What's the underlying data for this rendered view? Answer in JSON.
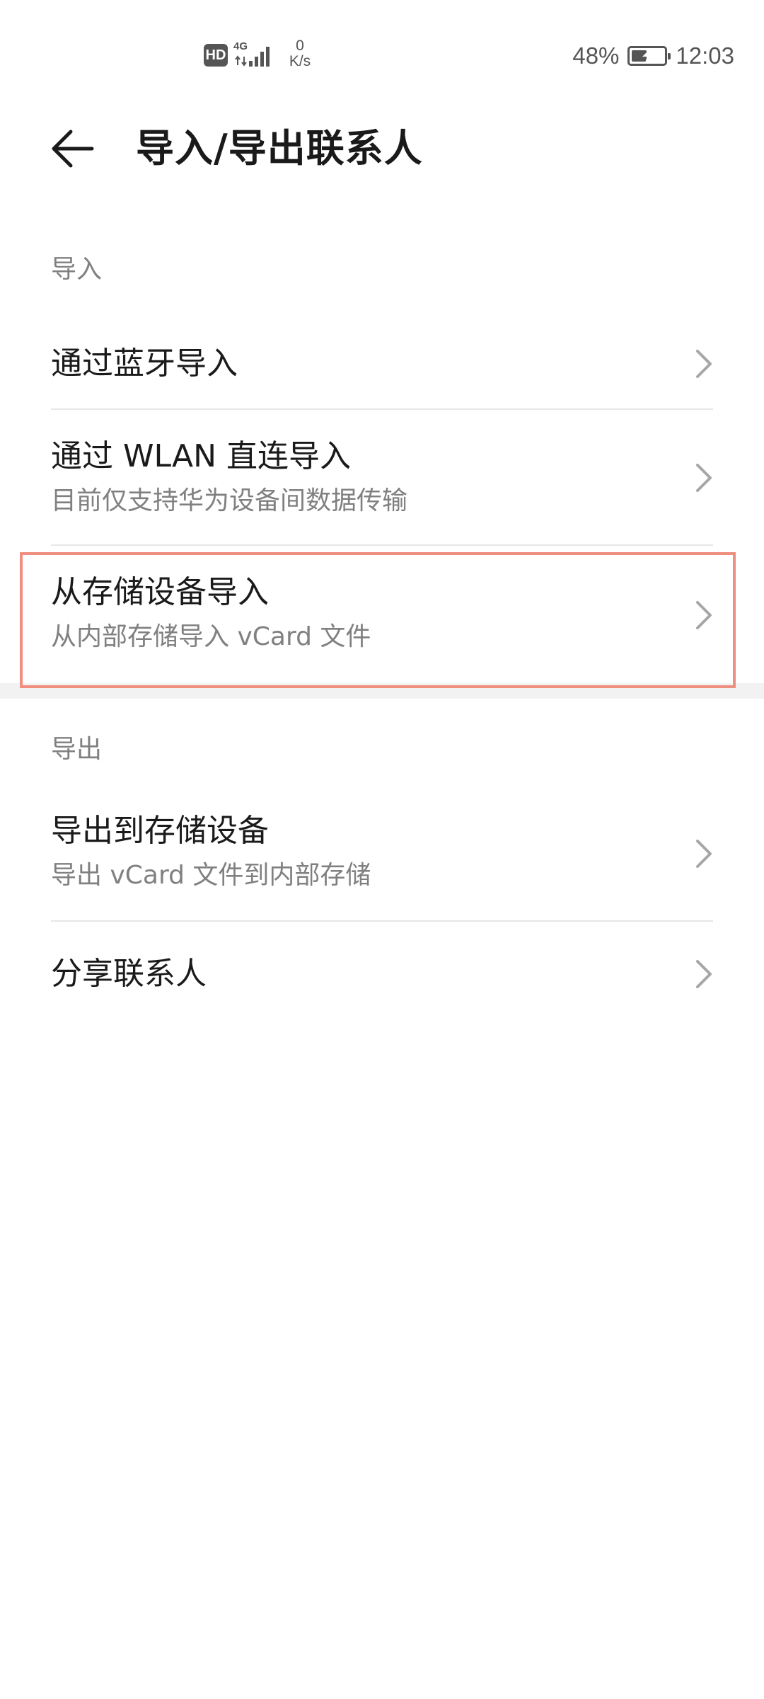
{
  "status_bar": {
    "hd": "HD",
    "network_type": "4G",
    "speed_value": "0",
    "speed_unit": "K/s",
    "battery_percent": "48%",
    "battery_level": 0.48,
    "time": "12:03"
  },
  "header": {
    "title": "导入/导出联系人",
    "back_icon": "back-arrow-icon"
  },
  "import_section": {
    "label": "导入",
    "items": [
      {
        "title": "通过蓝牙导入",
        "subtitle": ""
      },
      {
        "title": "通过 WLAN 直连导入",
        "subtitle": "目前仅支持华为设备间数据传输"
      },
      {
        "title": "从存储设备导入",
        "subtitle": "从内部存储导入 vCard 文件"
      }
    ]
  },
  "export_section": {
    "label": "导出",
    "items": [
      {
        "title": "导出到存储设备",
        "subtitle": "导出 vCard 文件到内部存储"
      },
      {
        "title": "分享联系人",
        "subtitle": ""
      }
    ]
  },
  "colors": {
    "highlight": "#ef8f80",
    "text_primary": "#1a1a1a",
    "text_secondary": "#808080"
  }
}
